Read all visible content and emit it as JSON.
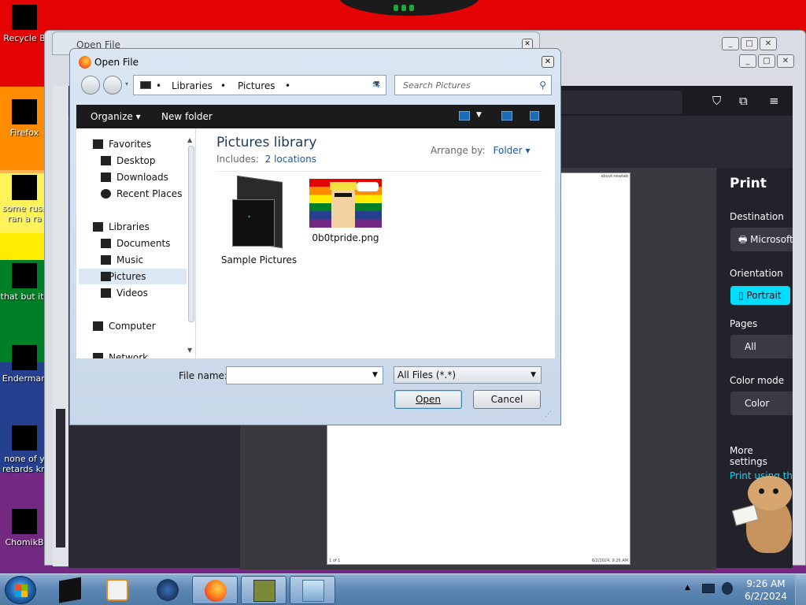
{
  "desktop": {
    "icons": [
      {
        "label": "Recycle B"
      },
      {
        "label": "Firefox"
      },
      {
        "label": "some russ",
        "label2": "ran a ra"
      },
      {
        "label": "that but its"
      },
      {
        "label": "Enderman"
      },
      {
        "label": "none of y",
        "label2": "retards kn"
      },
      {
        "label": "ChomikB"
      }
    ]
  },
  "background_window": {
    "title": "Open File"
  },
  "firefox_print": {
    "title": "Print",
    "destination_label": "Destination",
    "destination_value": "Microsoft",
    "orientation_label": "Orientation",
    "orientation_value": "Portrait",
    "pages_label": "Pages",
    "pages_value": "All",
    "color_mode_label": "Color mode",
    "color_mode_value": "Color",
    "more_settings": "More settings",
    "print_using_system": "Print using the s",
    "page_header_right": "about:newtab",
    "page_footer_left": "1 of 1",
    "page_footer_right": "6/2/2024, 9:26 AM"
  },
  "dialog": {
    "title": "Open File",
    "breadcrumb": [
      "Libraries",
      "Pictures"
    ],
    "search_placeholder": "Search Pictures",
    "toolbar": {
      "organize": "Organize",
      "new_folder": "New folder"
    },
    "nav_tree": {
      "favorites": "Favorites",
      "desktop": "Desktop",
      "downloads": "Downloads",
      "recent_places": "Recent Places",
      "libraries": "Libraries",
      "documents": "Documents",
      "music": "Music",
      "pictures": "Pictures",
      "videos": "Videos",
      "computer": "Computer",
      "network": "Network"
    },
    "library_title": "Pictures library",
    "includes_label": "Includes:",
    "includes_link": "2 locations",
    "arrange_by_label": "Arrange by:",
    "arrange_by_value": "Folder",
    "files": [
      {
        "name": "Sample Pictures"
      },
      {
        "name": "0b0tpride.png"
      }
    ],
    "file_name_label": "File name:",
    "file_name_value": "",
    "file_type": "All Files (*.*)",
    "open_button": "Open",
    "cancel_button": "Cancel"
  },
  "taskbar": {
    "time": "9:26 AM",
    "date": "6/2/2024"
  }
}
